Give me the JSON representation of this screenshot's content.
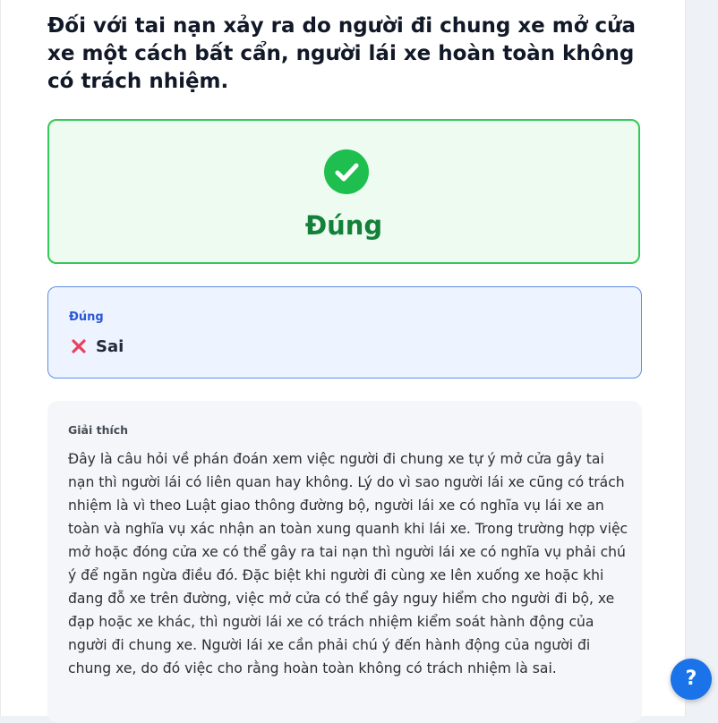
{
  "question": {
    "text": "Đối với tai nạn xảy ra do người đi chung xe mở cửa xe một cách bất cẩn, người lái xe hoàn toàn không có trách nhiệm."
  },
  "result": {
    "label": "Đúng",
    "icon": "check-circle-icon",
    "color": "#1fbf4f"
  },
  "answer": {
    "correct_label": "Đúng",
    "user_answer": "Sai",
    "user_answer_icon": "cross-icon"
  },
  "explanation": {
    "title": "Giải thích",
    "text": "Đây là câu hỏi về phán đoán xem việc người đi chung xe tự ý mở cửa gây tai nạn thì người lái có liên quan hay không. Lý do vì sao người lái xe cũng có trách nhiệm là vì theo Luật giao thông đường bộ, người lái xe có nghĩa vụ lái xe an toàn và nghĩa vụ xác nhận an toàn xung quanh khi lái xe. Trong trường hợp việc mở hoặc đóng cửa xe có thể gây ra tai nạn thì người lái xe có nghĩa vụ phải chú ý để ngăn ngừa điều đó. Đặc biệt khi người đi cùng xe lên xuống xe hoặc khi đang đỗ xe trên đường, việc mở cửa có thể gây nguy hiểm cho người đi bộ, xe đạp hoặc xe khác, thì người lái xe có trách nhiệm kiểm soát hành động của người đi chung xe. Người lái xe cần phải chú ý đến hành động của người đi chung xe, do đó việc cho rằng hoàn toàn không có trách nhiệm là sai."
  },
  "help_button": {
    "label": "?",
    "color": "#1a73e8"
  }
}
